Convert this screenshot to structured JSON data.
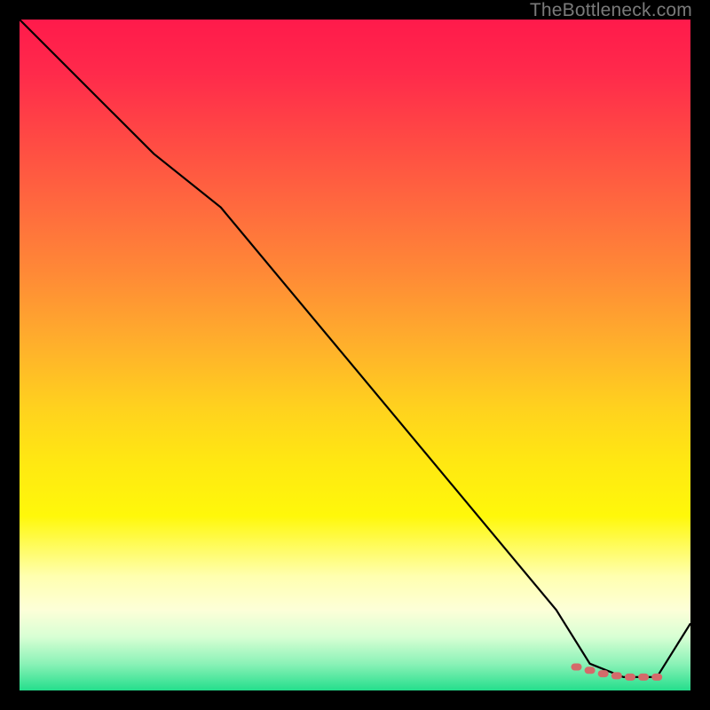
{
  "watermark": "TheBottleneck.com",
  "chart_data": {
    "type": "line",
    "title": "",
    "xlabel": "",
    "ylabel": "",
    "xlim": [
      0,
      100
    ],
    "ylim": [
      0,
      100
    ],
    "grid": false,
    "legend": false,
    "series": [
      {
        "name": "curve",
        "color": "#000000",
        "x": [
          0,
          10,
          20,
          30,
          40,
          50,
          60,
          70,
          80,
          85,
          90,
          95,
          100
        ],
        "y": [
          100,
          90,
          80,
          72,
          60,
          48,
          36,
          24,
          12,
          4,
          2,
          2,
          10
        ]
      }
    ],
    "markers": {
      "name": "segment-highlight",
      "color": "#d46a6a",
      "x": [
        83,
        85,
        87,
        89,
        91,
        93,
        95
      ],
      "y": [
        3.5,
        3,
        2.5,
        2.2,
        2,
        2,
        2
      ]
    }
  }
}
